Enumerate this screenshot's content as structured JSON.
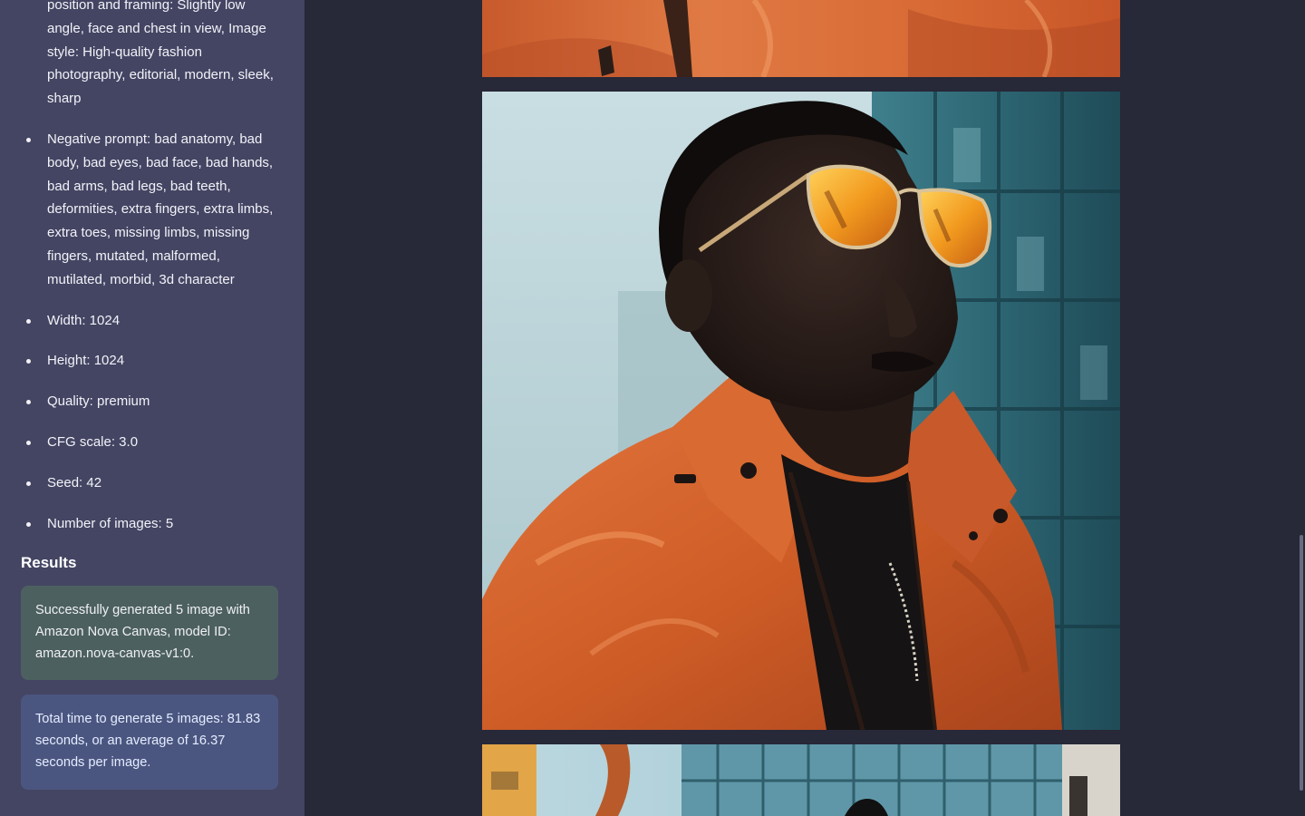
{
  "sidebar": {
    "params": [
      {
        "text": "position and framing: Slightly low angle, face and chest in view, Image style: High-quality fashion photography, editorial, modern, sleek, sharp",
        "continued": true
      },
      {
        "text": "Negative prompt: bad anatomy, bad body, bad eyes, bad face, bad hands, bad arms, bad legs, bad teeth, deformities, extra fingers, extra limbs, extra toes, missing limbs, missing fingers, mutated, malformed, mutilated, morbid, 3d character"
      },
      {
        "text": "Width: 1024"
      },
      {
        "text": "Height: 1024"
      },
      {
        "text": "Quality: premium"
      },
      {
        "text": "CFG scale: 3.0"
      },
      {
        "text": "Seed: 42"
      },
      {
        "text": "Number of images: 5"
      }
    ],
    "results_heading": "Results",
    "success_message": "Successfully generated 5 image with Amazon Nova Canvas, model ID: amazon.nova-canvas-v1:0.",
    "info_message": "Total time to generate 5 images: 81.83 seconds, or an average of 16.37 seconds per image."
  },
  "main": {
    "images": [
      {
        "subject": "orange jacket closeup"
      },
      {
        "subject": "man with orange sunglasses and orange jacket"
      },
      {
        "subject": "man in front of glass building"
      }
    ]
  },
  "colors": {
    "sidebar_bg": "#444563",
    "main_bg": "#272838",
    "success_bg": "#4d6060",
    "info_bg": "#4b5680",
    "jacket_orange": "#d9642a"
  }
}
